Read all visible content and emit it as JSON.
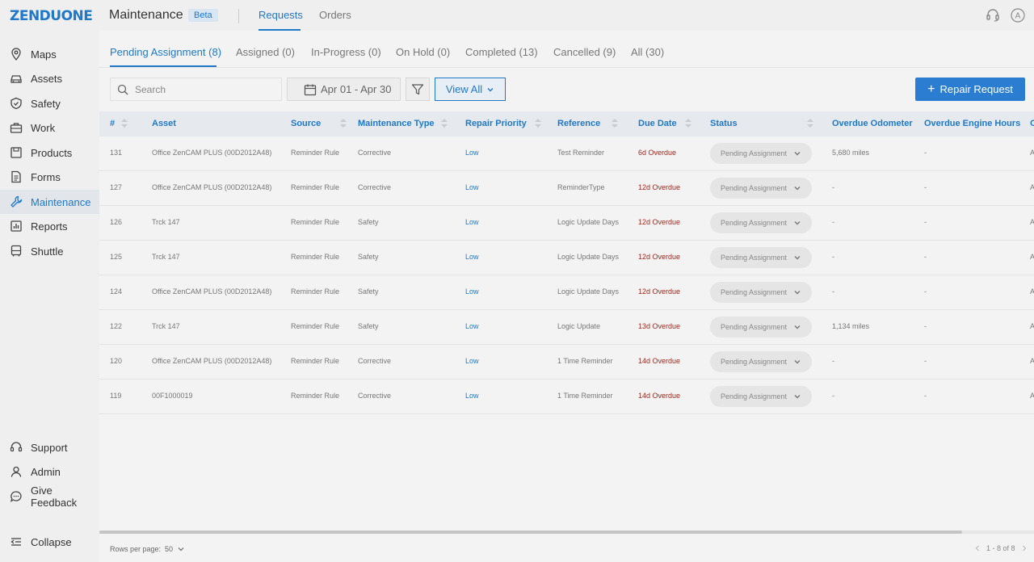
{
  "header": {
    "logo_main": "ZENDU",
    "logo_accent": "ONE",
    "page_title": "Maintenance",
    "badge": "Beta",
    "tabs": [
      {
        "label": "Requests",
        "active": true
      },
      {
        "label": "Orders",
        "active": false
      }
    ],
    "icons": [
      "support-icon",
      "account-icon"
    ],
    "account_initial": "A"
  },
  "sidebar": {
    "items": [
      {
        "label": "Maps",
        "icon": "map-pin-icon",
        "active": false
      },
      {
        "label": "Assets",
        "icon": "car-icon",
        "active": false
      },
      {
        "label": "Safety",
        "icon": "shield-icon",
        "active": false
      },
      {
        "label": "Work",
        "icon": "briefcase-icon",
        "active": false
      },
      {
        "label": "Products",
        "icon": "box-icon",
        "active": false
      },
      {
        "label": "Forms",
        "icon": "form-icon",
        "active": false
      },
      {
        "label": "Maintenance",
        "icon": "wrench-icon",
        "active": true
      },
      {
        "label": "Reports",
        "icon": "chart-icon",
        "active": false
      },
      {
        "label": "Shuttle",
        "icon": "bus-icon",
        "active": false
      }
    ],
    "bottom_items": [
      {
        "label": "Support",
        "icon": "headset-icon"
      },
      {
        "label": "Admin",
        "icon": "user-icon"
      },
      {
        "label": "Give Feedback",
        "icon": "chat-icon"
      },
      {
        "label": "Collapse",
        "icon": "collapse-icon"
      }
    ]
  },
  "status_tabs": [
    {
      "label": "Pending Assignment (8)",
      "active": true
    },
    {
      "label": "Assigned (0)",
      "active": false
    },
    {
      "label": "In-Progress (0)",
      "active": false
    },
    {
      "label": "On Hold (0)",
      "active": false
    },
    {
      "label": "Completed (13)",
      "active": false
    },
    {
      "label": "Cancelled (9)",
      "active": false
    },
    {
      "label": "All (30)",
      "active": false
    }
  ],
  "toolbar": {
    "search_placeholder": "Search",
    "date_range": "Apr 01 - Apr 30",
    "view_all_label": "View All",
    "repair_request_label": "Repair Request"
  },
  "table": {
    "columns": [
      "#",
      "Asset",
      "Source",
      "Maintenance Type",
      "Repair Priority",
      "Reference",
      "Due Date",
      "Status",
      "Overdue Odometer",
      "Overdue Engine Hours",
      "O"
    ],
    "rows": [
      {
        "id": "131",
        "asset": "Office ZenCAM PLUS (00D2012A48)",
        "source": "Reminder Rule",
        "type": "Corrective",
        "priority": "Low",
        "reference": "Test Reminder",
        "due": "6d Overdue",
        "status": "Pending Assignment",
        "odometer": "5,680 miles",
        "engine_hours": "-",
        "extra": "A"
      },
      {
        "id": "127",
        "asset": "Office ZenCAM PLUS (00D2012A48)",
        "source": "Reminder Rule",
        "type": "Corrective",
        "priority": "Low",
        "reference": "ReminderType",
        "due": "12d Overdue",
        "status": "Pending Assignment",
        "odometer": "-",
        "engine_hours": "-",
        "extra": "A"
      },
      {
        "id": "126",
        "asset": "Trck 147",
        "source": "Reminder Rule",
        "type": "Safety",
        "priority": "Low",
        "reference": "Logic Update Days",
        "due": "12d Overdue",
        "status": "Pending Assignment",
        "odometer": "-",
        "engine_hours": "-",
        "extra": "A"
      },
      {
        "id": "125",
        "asset": "Trck 147",
        "source": "Reminder Rule",
        "type": "Safety",
        "priority": "Low",
        "reference": "Logic Update Days",
        "due": "12d Overdue",
        "status": "Pending Assignment",
        "odometer": "-",
        "engine_hours": "-",
        "extra": "A"
      },
      {
        "id": "124",
        "asset": "Office ZenCAM PLUS (00D2012A48)",
        "source": "Reminder Rule",
        "type": "Safety",
        "priority": "Low",
        "reference": "Logic Update Days",
        "due": "12d Overdue",
        "status": "Pending Assignment",
        "odometer": "-",
        "engine_hours": "-",
        "extra": "A"
      },
      {
        "id": "122",
        "asset": "Trck 147",
        "source": "Reminder Rule",
        "type": "Safety",
        "priority": "Low",
        "reference": "Logic Update",
        "due": "13d Overdue",
        "status": "Pending Assignment",
        "odometer": "1,134 miles",
        "engine_hours": "-",
        "extra": "A"
      },
      {
        "id": "120",
        "asset": "Office ZenCAM PLUS (00D2012A48)",
        "source": "Reminder Rule",
        "type": "Corrective",
        "priority": "Low",
        "reference": "1 Time Reminder",
        "due": "14d Overdue",
        "status": "Pending Assignment",
        "odometer": "-",
        "engine_hours": "-",
        "extra": "A"
      },
      {
        "id": "119",
        "asset": "00F1000019",
        "source": "Reminder Rule",
        "type": "Corrective",
        "priority": "Low",
        "reference": "1 Time Reminder",
        "due": "14d Overdue",
        "status": "Pending Assignment",
        "odometer": "-",
        "engine_hours": "-",
        "extra": "A"
      }
    ]
  },
  "footer": {
    "rows_per_page_label": "Rows per page:",
    "rows_per_page_value": "50",
    "range": "1 - 8 of 8"
  },
  "colors": {
    "accent": "#1f78c8",
    "overdue": "#a0281e",
    "button": "#2a7dd0"
  }
}
